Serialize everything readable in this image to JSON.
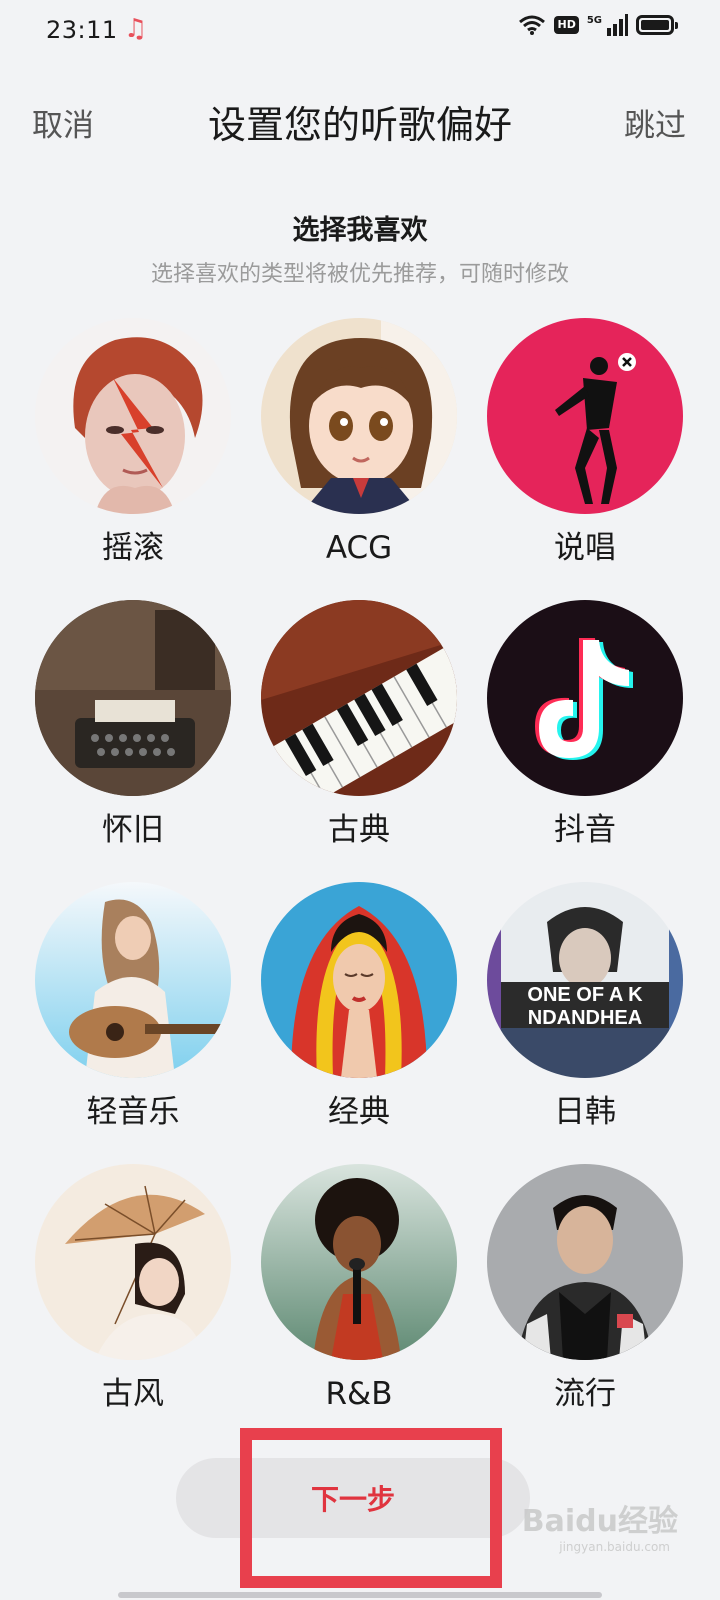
{
  "status_bar": {
    "time": "23:11",
    "music_icon": "music-note-icon",
    "wifi_icon": "wifi-icon",
    "hd_label": "HD",
    "network_label": "5G",
    "signal_icon": "signal-icon",
    "battery_icon": "battery-icon"
  },
  "header": {
    "cancel_label": "取消",
    "title": "设置您的听歌偏好",
    "skip_label": "跳过"
  },
  "section": {
    "title": "选择我喜欢",
    "subtitle": "选择喜欢的类型将被优先推荐，可随时修改"
  },
  "genres": [
    {
      "label": "摇滚"
    },
    {
      "label": "ACG"
    },
    {
      "label": "说唱"
    },
    {
      "label": "怀旧"
    },
    {
      "label": "古典"
    },
    {
      "label": "抖音"
    },
    {
      "label": "轻音乐"
    },
    {
      "label": "经典"
    },
    {
      "label": "日韩"
    },
    {
      "label": "古风"
    },
    {
      "label": "R&B"
    },
    {
      "label": "流行"
    }
  ],
  "next_button_label": "下一步",
  "colors": {
    "accent": "#e0343f",
    "highlight": "#e8404d"
  },
  "watermark": {
    "brand": "Baidu经验",
    "url": "jingyan.baidu.com"
  }
}
